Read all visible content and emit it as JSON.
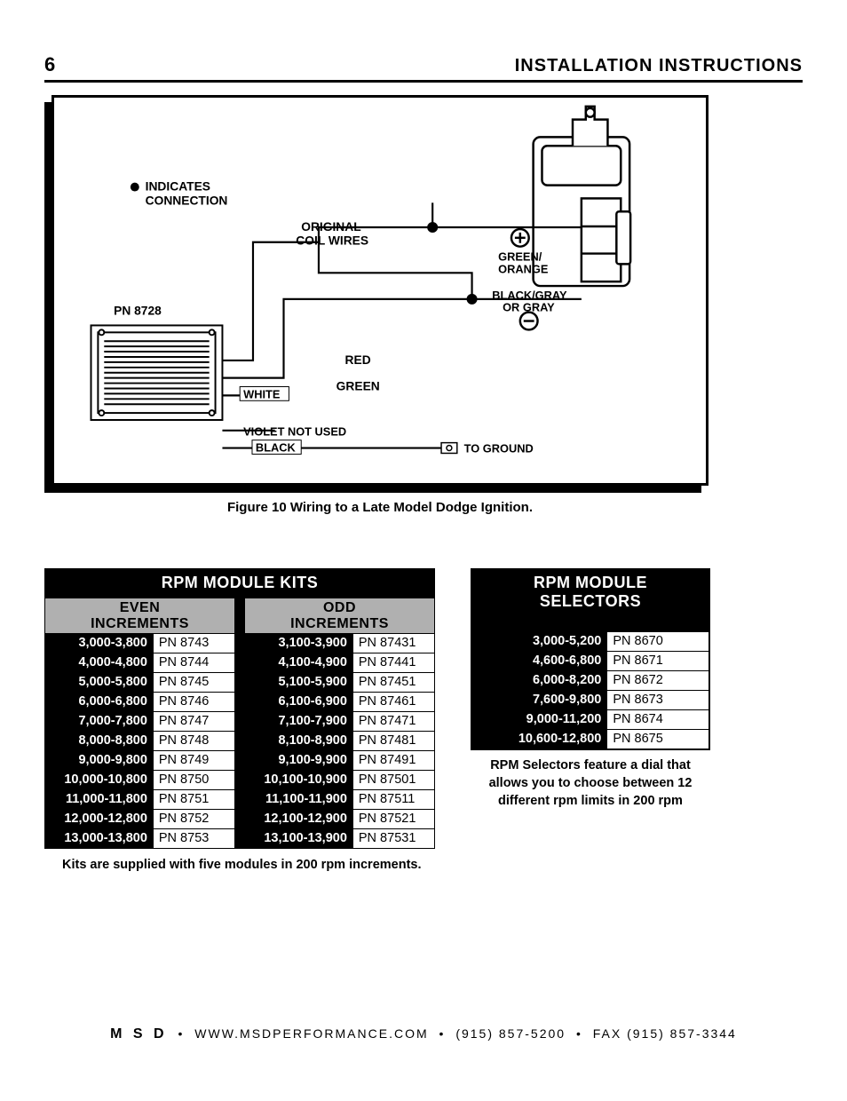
{
  "header": {
    "page_number": "6",
    "title": "INSTALLATION INSTRUCTIONS"
  },
  "diagram": {
    "labels": {
      "indicates": "INDICATES",
      "connection": "CONNECTION",
      "original1": "ORIGINAL",
      "original2": "COIL WIRES",
      "pn8728": "PN 8728",
      "green_orange1": "GREEN/",
      "green_orange2": "ORANGE",
      "black_gray1": "BLACK/GRAY",
      "black_gray2": "OR GRAY",
      "red": "RED",
      "green": "GREEN",
      "white": "WHITE",
      "violet": "VIOLET NOT USED",
      "black": "BLACK",
      "to_ground": "TO GROUND"
    },
    "caption": "Figure 10  Wiring to a Late Model Dodge Ignition."
  },
  "kits": {
    "title": "RPM MODULE KITS",
    "even_header1": "EVEN",
    "even_header2": "INCREMENTS",
    "odd_header1": "ODD",
    "odd_header2": "INCREMENTS",
    "even_rows": [
      {
        "range": "3,000-3,800",
        "pn": "PN 8743"
      },
      {
        "range": "4,000-4,800",
        "pn": "PN 8744"
      },
      {
        "range": "5,000-5,800",
        "pn": "PN 8745"
      },
      {
        "range": "6,000-6,800",
        "pn": "PN 8746"
      },
      {
        "range": "7,000-7,800",
        "pn": "PN 8747"
      },
      {
        "range": "8,000-8,800",
        "pn": "PN 8748"
      },
      {
        "range": "9,000-9,800",
        "pn": "PN 8749"
      },
      {
        "range": "10,000-10,800",
        "pn": "PN 8750"
      },
      {
        "range": "11,000-11,800",
        "pn": "PN 8751"
      },
      {
        "range": "12,000-12,800",
        "pn": "PN 8752"
      },
      {
        "range": "13,000-13,800",
        "pn": "PN 8753"
      }
    ],
    "odd_rows": [
      {
        "range": "3,100-3,900",
        "pn": "PN 87431"
      },
      {
        "range": "4,100-4,900",
        "pn": "PN 87441"
      },
      {
        "range": "5,100-5,900",
        "pn": "PN 87451"
      },
      {
        "range": "6,100-6,900",
        "pn": "PN 87461"
      },
      {
        "range": "7,100-7,900",
        "pn": "PN 87471"
      },
      {
        "range": "8,100-8,900",
        "pn": "PN 87481"
      },
      {
        "range": "9,100-9,900",
        "pn": "PN 87491"
      },
      {
        "range": "10,100-10,900",
        "pn": "PN 87501"
      },
      {
        "range": "11,100-11,900",
        "pn": "PN 87511"
      },
      {
        "range": "12,100-12,900",
        "pn": "PN 87521"
      },
      {
        "range": "13,100-13,900",
        "pn": "PN 87531"
      }
    ],
    "note": "Kits are supplied with five modules in 200 rpm increments."
  },
  "selectors": {
    "title1": "RPM MODULE",
    "title2": "SELECTORS",
    "rows": [
      {
        "range": "3,000-5,200",
        "pn": "PN 8670"
      },
      {
        "range": "4,600-6,800",
        "pn": "PN 8671"
      },
      {
        "range": "6,000-8,200",
        "pn": "PN 8672"
      },
      {
        "range": "7,600-9,800",
        "pn": "PN 8673"
      },
      {
        "range": "9,000-11,200",
        "pn": "PN 8674"
      },
      {
        "range": "10,600-12,800",
        "pn": "PN 8675"
      }
    ],
    "note": "RPM Selectors feature a dial that allows you to choose between 12 different rpm limits in 200 rpm"
  },
  "footer": {
    "brand": "M S D",
    "site": "WWW.MSDPERFORMANCE.COM",
    "phone": "(915) 857-5200",
    "fax": "FAX (915) 857-3344"
  }
}
